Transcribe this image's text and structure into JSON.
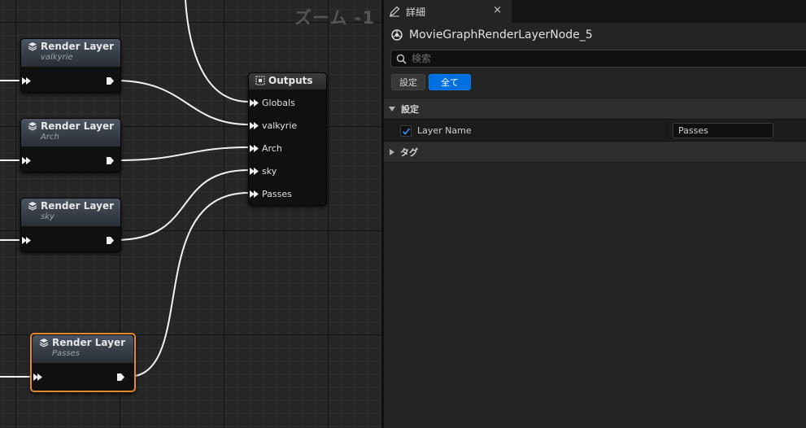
{
  "graph": {
    "zoom_label": "ズーム -1",
    "render_nodes": [
      {
        "title": "Render Layer",
        "subtitle": "valkyrie"
      },
      {
        "title": "Render Layer",
        "subtitle": "Arch"
      },
      {
        "title": "Render Layer",
        "subtitle": "sky"
      },
      {
        "title": "Render Layer",
        "subtitle": "Passes",
        "selected": true
      }
    ],
    "outputs_node": {
      "title": "Outputs",
      "pins": [
        "Globals",
        "valkyrie",
        "Arch",
        "sky",
        "Passes"
      ]
    }
  },
  "details": {
    "tab_label": "詳細",
    "tab_close": "×",
    "object_name": "MovieGraphRenderLayerNode_5",
    "search_placeholder": "検索",
    "filter_buttons": [
      "設定",
      "全て"
    ],
    "active_filter": "全て",
    "section_settings": "設定",
    "property_label": "Layer Name",
    "property_checked": true,
    "property_value": "Passes",
    "section_tags": "タグ"
  },
  "colors": {
    "selection_outline": "#e3892d",
    "active_filter": "#0070e0",
    "wire": "#ffffff"
  }
}
